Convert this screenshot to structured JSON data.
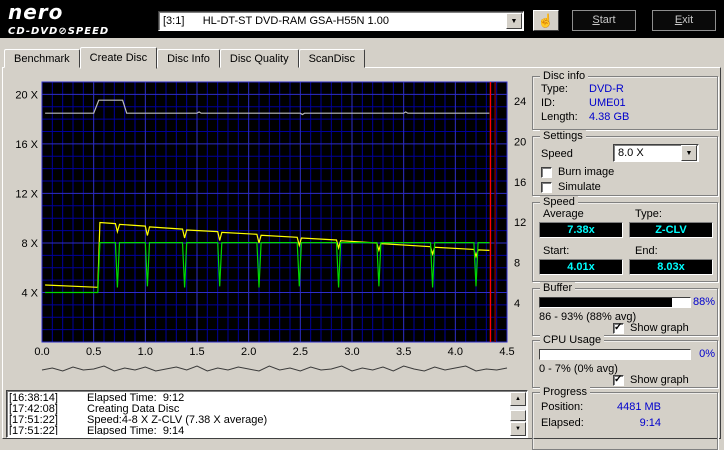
{
  "header": {
    "logo1": "nero",
    "logo2": "CD-DVD",
    "speed_glyph": "⊘",
    "speed_word": "SPEED",
    "drive": "[3:1]      HL-DT-ST DVD-RAM GSA-H55N 1.00",
    "start_u": "S",
    "start_rest": "tart",
    "exit_u": "E",
    "exit_rest": "xit"
  },
  "tabs": [
    "Benchmark",
    "Create Disc",
    "Disc Info",
    "Disc Quality",
    "ScanDisc"
  ],
  "panels": {
    "disc_info": {
      "legend": "Disc info",
      "rows": [
        {
          "label": "Type:",
          "value": "DVD-R"
        },
        {
          "label": "ID:",
          "value": "UME01"
        },
        {
          "label": "Length:",
          "value": "4.38 GB"
        }
      ]
    },
    "settings": {
      "legend": "Settings",
      "speed_label": "Speed",
      "speed_value": "8.0 X",
      "burn_image": "Burn image",
      "simulate": "Simulate"
    },
    "speed": {
      "legend": "Speed",
      "average_label": "Average",
      "type_label": "Type:",
      "start_label": "Start:",
      "end_label": "End:",
      "average": "7.38x",
      "type": "Z-CLV",
      "start": "4.01x",
      "end": "8.03x"
    },
    "buffer": {
      "legend": "Buffer",
      "percent": "88%",
      "fill": 88,
      "range": "86 - 93% (88% avg)",
      "show_graph": "Show graph"
    },
    "cpu": {
      "legend": "CPU Usage",
      "percent": "0%",
      "fill": 0,
      "range": "0 - 7% (0% avg)",
      "show_graph": "Show graph"
    },
    "progress": {
      "legend": "Progress",
      "position_label": "Position:",
      "position": "4481 MB",
      "elapsed_label": "Elapsed:",
      "elapsed": "9:14"
    }
  },
  "log": {
    "lines": [
      {
        "time": "[16:38:14]",
        "text": "Elapsed Time:  9:12"
      },
      {
        "time": "[17:42:08]",
        "text": "Creating Data Disc"
      },
      {
        "time": "[17:51:22]",
        "text": "Speed:4-8 X Z-CLV (7.38 X average)"
      },
      {
        "time": "[17:51:22]",
        "text": "Elapsed Time:  9:14"
      }
    ]
  },
  "chart_data": {
    "type": "line",
    "x_range": [
      0,
      4.5
    ],
    "y_range": [
      0,
      21
    ],
    "grid": {
      "bg": "#000000",
      "minor_color": "#00009b",
      "major_color": "#2e2ec8"
    },
    "left_ticks": [
      {
        "v": 20,
        "label": "20 X"
      },
      {
        "v": 16,
        "label": "16 X"
      },
      {
        "v": 12,
        "label": "12 X"
      },
      {
        "v": 8,
        "label": "8 X"
      },
      {
        "v": 4,
        "label": "4 X"
      }
    ],
    "right_ticks": [
      "24",
      "20",
      "16",
      "12",
      "8",
      "4"
    ],
    "x_ticks": [
      {
        "v": 0,
        "label": "0.0"
      },
      {
        "v": 0.5,
        "label": "0.5"
      },
      {
        "v": 1,
        "label": "1.0"
      },
      {
        "v": 1.5,
        "label": "1.5"
      },
      {
        "v": 2,
        "label": "2.0"
      },
      {
        "v": 2.5,
        "label": "2.5"
      },
      {
        "v": 3,
        "label": "3.0"
      },
      {
        "v": 3.5,
        "label": "3.5"
      },
      {
        "v": 4,
        "label": "4.0"
      },
      {
        "v": 4.5,
        "label": "4.5"
      }
    ],
    "series": [
      {
        "name": "buffer-level",
        "color": "#bdbdbd",
        "scale": "percent",
        "points": [
          [
            0.03,
            88
          ],
          [
            0.5,
            88
          ],
          [
            0.55,
            93
          ],
          [
            0.78,
            93
          ],
          [
            0.82,
            88
          ],
          [
            1.5,
            88
          ],
          [
            1.52,
            88.5
          ],
          [
            1.54,
            88
          ],
          [
            2.5,
            88
          ],
          [
            2.52,
            87.5
          ],
          [
            2.54,
            88
          ],
          [
            3.5,
            88
          ],
          [
            3.52,
            88.5
          ],
          [
            3.54,
            88
          ],
          [
            4.33,
            88
          ]
        ]
      },
      {
        "name": "rotation-speed",
        "color": "#ffff00",
        "scale": "x",
        "points": [
          [
            0.03,
            4.6
          ],
          [
            0.54,
            4.42
          ],
          [
            0.56,
            9.65
          ],
          [
            0.71,
            9.56
          ],
          [
            0.73,
            8.9
          ],
          [
            0.75,
            9.5
          ],
          [
            1.0,
            9.36
          ],
          [
            1.02,
            8.6
          ],
          [
            1.04,
            9.3
          ],
          [
            1.36,
            9.12
          ],
          [
            1.38,
            8.4
          ],
          [
            1.4,
            9.05
          ],
          [
            1.7,
            8.92
          ],
          [
            1.72,
            8.2
          ],
          [
            1.74,
            8.85
          ],
          [
            2.08,
            8.7
          ],
          [
            2.1,
            8.0
          ],
          [
            2.12,
            8.62
          ],
          [
            2.47,
            8.46
          ],
          [
            2.49,
            7.8
          ],
          [
            2.51,
            8.4
          ],
          [
            2.85,
            8.24
          ],
          [
            2.87,
            7.6
          ],
          [
            2.89,
            8.18
          ],
          [
            3.24,
            8.0
          ],
          [
            3.26,
            7.4
          ],
          [
            3.28,
            7.95
          ],
          [
            3.76,
            7.7
          ],
          [
            3.78,
            7.1
          ],
          [
            3.8,
            7.65
          ],
          [
            4.18,
            7.48
          ],
          [
            4.2,
            6.9
          ],
          [
            4.22,
            7.44
          ],
          [
            4.33,
            7.4
          ]
        ]
      },
      {
        "name": "write-speed",
        "color": "#00d800",
        "scale": "x",
        "points": [
          [
            0.03,
            4.0
          ],
          [
            0.54,
            4.0
          ],
          [
            0.56,
            8.03
          ],
          [
            0.71,
            8.03
          ],
          [
            0.73,
            4.4
          ],
          [
            0.75,
            8.03
          ],
          [
            1.0,
            8.03
          ],
          [
            1.02,
            4.5
          ],
          [
            1.04,
            8.03
          ],
          [
            1.36,
            8.03
          ],
          [
            1.38,
            4.4
          ],
          [
            1.4,
            8.03
          ],
          [
            1.7,
            8.03
          ],
          [
            1.72,
            4.5
          ],
          [
            1.74,
            8.03
          ],
          [
            2.08,
            8.03
          ],
          [
            2.1,
            4.4
          ],
          [
            2.12,
            8.03
          ],
          [
            2.47,
            8.03
          ],
          [
            2.49,
            4.5
          ],
          [
            2.51,
            8.03
          ],
          [
            2.85,
            8.03
          ],
          [
            2.87,
            4.4
          ],
          [
            2.89,
            8.03
          ],
          [
            3.24,
            8.03
          ],
          [
            3.26,
            4.5
          ],
          [
            3.28,
            8.03
          ],
          [
            3.76,
            8.03
          ],
          [
            3.78,
            4.4
          ],
          [
            3.8,
            8.03
          ],
          [
            4.18,
            8.03
          ],
          [
            4.2,
            4.5
          ],
          [
            4.22,
            8.03
          ],
          [
            4.33,
            8.03
          ]
        ]
      }
    ],
    "markers": [
      {
        "type": "vline",
        "x": 4.34,
        "color": "#ff0000"
      },
      {
        "type": "vline",
        "x": 4.385,
        "color": "#7b0000"
      }
    ],
    "cpu_graph": [
      2,
      4,
      1,
      5,
      2,
      3,
      6,
      1,
      4,
      2,
      5,
      1,
      3,
      5,
      2,
      6,
      1,
      4,
      2,
      5,
      3,
      1,
      6,
      2,
      4,
      1,
      5,
      2,
      3,
      6,
      1,
      4,
      2,
      5,
      1,
      6,
      3,
      1,
      5,
      2,
      4,
      6,
      1,
      3,
      2,
      4
    ]
  }
}
